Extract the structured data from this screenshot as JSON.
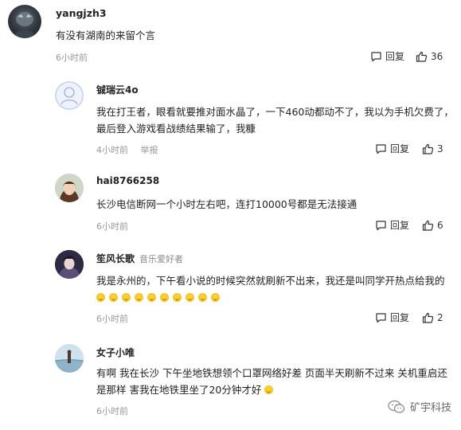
{
  "top_comment": {
    "username": "yangjzh3",
    "text": "有没有湖南的来留个言",
    "time": "6小时前",
    "reply_label": "回复",
    "likes": "36"
  },
  "replies": [
    {
      "username": "铖瑞云4o",
      "tag": "",
      "text": "我在打王者，眼看就要推对面水晶了，一下460动都动不了，我以为手机欠费了，最后登入游戏看战绩结果输了，我糠",
      "time": "4小时前",
      "report_label": "举报",
      "reply_label": "回复",
      "likes": "3"
    },
    {
      "username": "hai8766258",
      "tag": "",
      "text": "长沙电信断网一个小时左右吧，连打10000号都是无法接通",
      "time": "6小时前",
      "report_label": "",
      "reply_label": "回复",
      "likes": "6"
    },
    {
      "username": "笙风长歌",
      "tag": "音乐爱好者",
      "text": "我是永州的，下午看小说的时候突然就刷新不出来，我还是叫同学开热点给我的",
      "time": "6小时前",
      "report_label": "",
      "reply_label": "回复",
      "likes": "2"
    },
    {
      "username": "女子小唯",
      "tag": "",
      "text": "有啊 我在长沙 下午坐地铁想领个口罩网络好差 页面半天刷新不过来 关机重启还是那样 害我在地铁里坐了20分钟才好",
      "time": "6小时前",
      "report_label": "",
      "reply_label": "",
      "likes": ""
    }
  ],
  "watermark": {
    "text": "矿宇科技"
  },
  "icons": {
    "comment": "comment-icon",
    "like": "thumbs-up-icon",
    "emoji": "laughing-emoji-icon",
    "wechat": "wechat-icon"
  },
  "colors": {
    "text": "#222222",
    "muted": "#999999",
    "tag": "#888888"
  }
}
